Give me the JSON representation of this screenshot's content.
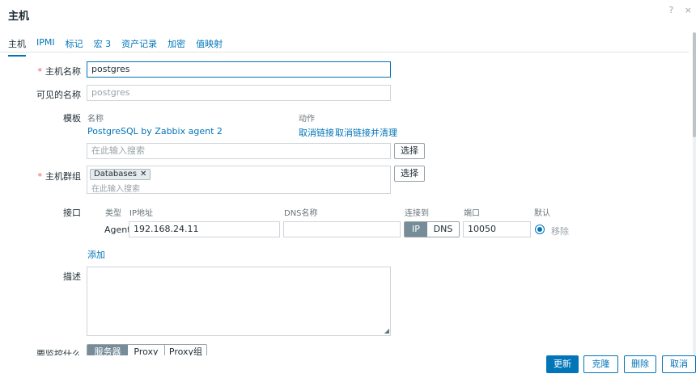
{
  "dialog": {
    "title": "主机",
    "help_icon": "?",
    "close_icon": "×"
  },
  "tabs": [
    {
      "label": "主机"
    },
    {
      "label": "IPMI"
    },
    {
      "label": "标记"
    },
    {
      "label": "宏 3"
    },
    {
      "label": "资产记录"
    },
    {
      "label": "加密"
    },
    {
      "label": "值映射"
    }
  ],
  "form": {
    "host_name": {
      "label": "主机名称",
      "required": "*",
      "value": "postgres"
    },
    "visible_name": {
      "label": "可见的名称",
      "placeholder": "postgres"
    },
    "templates": {
      "label": "模板",
      "col_name": "名称",
      "col_action": "动作",
      "items": [
        {
          "name": "PostgreSQL by Zabbix agent 2",
          "unlink": "取消链接",
          "unlink_clear": "取消链接并清理"
        }
      ],
      "search_placeholder": "在此输入搜索",
      "select_label": "选择"
    },
    "host_groups": {
      "label": "主机群组",
      "required": "*",
      "chip": "Databases",
      "search_placeholder": "在此输入搜索",
      "select_label": "选择"
    },
    "interfaces": {
      "label": "接口",
      "headers": {
        "type": "类型",
        "ip": "IP地址",
        "dns": "DNS名称",
        "connect": "连接到",
        "port": "端口",
        "default": "默认"
      },
      "rows": [
        {
          "type": "Agent",
          "ip": "192.168.24.11",
          "dns": "",
          "connect_ip": "IP",
          "connect_dns": "DNS",
          "port": "10050",
          "remove": "移除"
        }
      ],
      "add": "添加"
    },
    "description": {
      "label": "描述",
      "value": ""
    },
    "monitored_by": {
      "label": "要监控什么",
      "options": [
        "服务器",
        "Proxy",
        "Proxy组"
      ]
    }
  },
  "footer": {
    "update": "更新",
    "clone": "克隆",
    "delete": "删除",
    "cancel": "取消"
  },
  "colors": {
    "accent": "#0275b8",
    "required": "#e45959"
  }
}
